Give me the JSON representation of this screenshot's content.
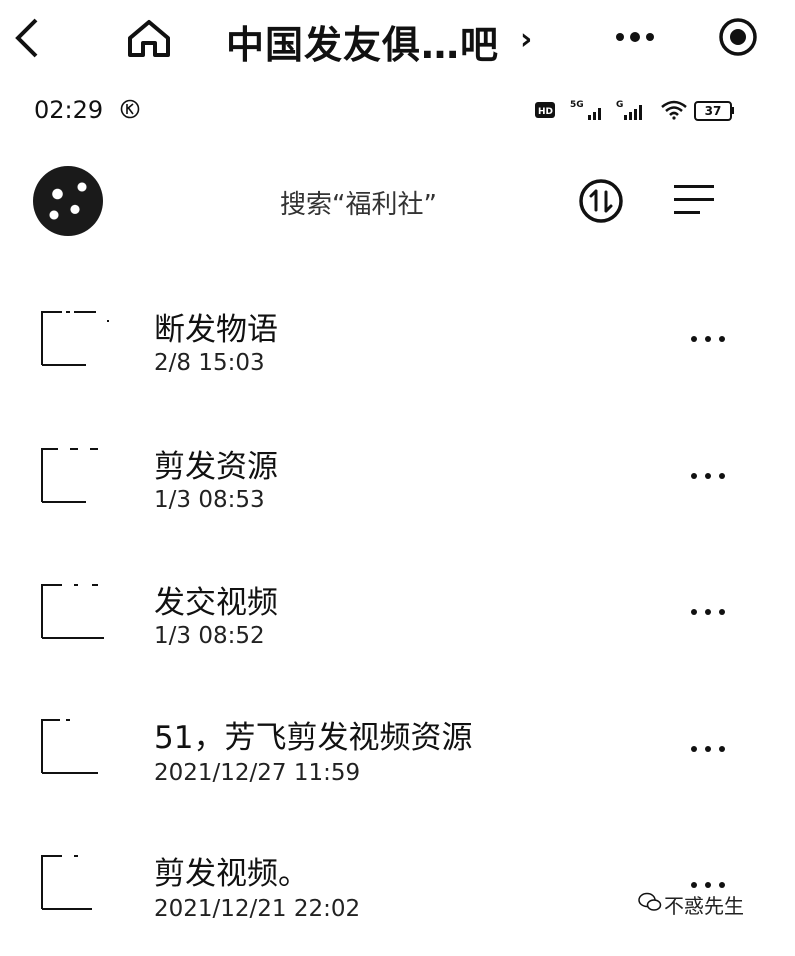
{
  "header": {
    "title": "中国发友俱…吧",
    "chevron": "›"
  },
  "statusbar": {
    "time": "02:29",
    "battery": "37"
  },
  "search": {
    "placeholder": "搜索“福利社”"
  },
  "folders": [
    {
      "name": "断发物语",
      "date": "2/8  15:03"
    },
    {
      "name": "剪发资源",
      "date": "1/3  08:53"
    },
    {
      "name": "发交视频",
      "date": "1/3  08:52"
    },
    {
      "name": "51，芳飞剪发视频资源",
      "date": "2021/12/27  11:59"
    },
    {
      "name": "剪发视频。",
      "date": "2021/12/21  22:02"
    }
  ],
  "watermark": {
    "text": "不惑先生"
  }
}
